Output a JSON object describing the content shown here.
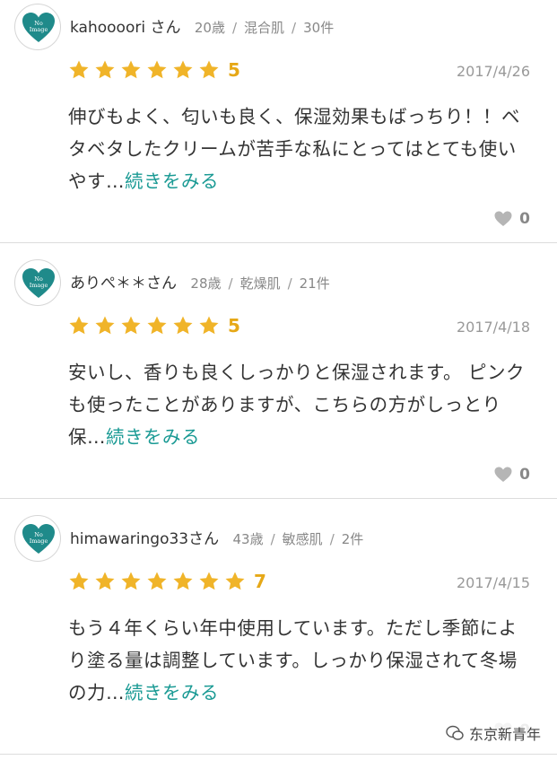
{
  "reviews": [
    {
      "avatar_text": "No Image",
      "user": "kahoooori さん",
      "age": "20歳",
      "skin": "混合肌",
      "count": "30件",
      "stars": 6,
      "score": "5",
      "date": "2017/4/26",
      "text": "伸びもよく、匂いも良く、保湿効果もばっちり！！ベタベタしたクリームが苦手な私にとってはとても使いやす…",
      "more": "続きをみる",
      "likes": "0"
    },
    {
      "avatar_text": "No Image",
      "user": "ありぺ＊＊さん",
      "age": "28歳",
      "skin": "乾燥肌",
      "count": "21件",
      "stars": 6,
      "score": "5",
      "date": "2017/4/18",
      "text": "安いし、香りも良くしっかりと保湿されます。 ピンクも使ったことがありますが、こちらの方がしっとり保…",
      "more": "続きをみる",
      "likes": "0"
    },
    {
      "avatar_text": "No Image",
      "user": "himawaringo33さん",
      "age": "43歳",
      "skin": "敏感肌",
      "count": "2件",
      "stars": 7,
      "score": "7",
      "date": "2017/4/15",
      "text": "もう４年くらい年中使用しています。ただし季節により塗る量は調整しています。しっかり保湿されて冬場の力…",
      "more": "続きをみる",
      "likes": "0"
    }
  ],
  "watermark": "东京新青年",
  "colors": {
    "star": "#f0b429",
    "link": "#1a9a94",
    "avatar_heart": "#1f8a8a"
  }
}
